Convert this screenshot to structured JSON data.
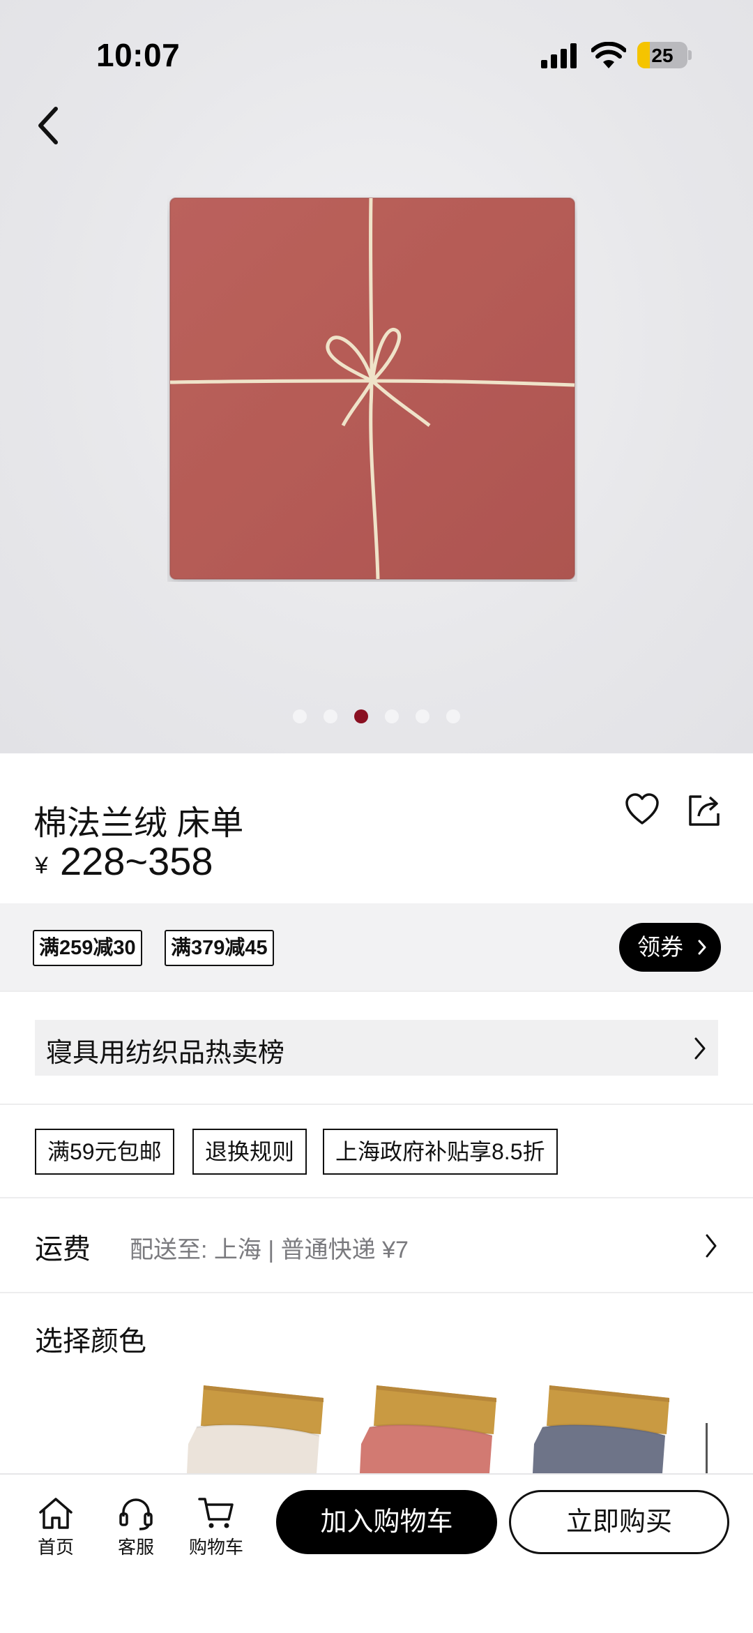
{
  "status_bar": {
    "time": "10:07",
    "battery": "25",
    "battery_level": 0.25
  },
  "carousel": {
    "total": 6,
    "active_index": 2
  },
  "product": {
    "name": "棉法兰绒 床单",
    "currency": "¥",
    "price_range": "228~358"
  },
  "promotions": {
    "tags": [
      "满259减30",
      "满379减45"
    ],
    "coupon_button": "领券"
  },
  "ranking": {
    "label": "寝具用纺织品热卖榜"
  },
  "services": [
    "满59元包邮",
    "退换规则",
    "上海政府补贴享8.5折"
  ],
  "shipping": {
    "label": "运费",
    "detail": "配送至:  上海 | 普通快递 ¥7"
  },
  "color_select": {
    "title": "选择颜色",
    "swatches": [
      {
        "name": "ivory",
        "color": "#ebe3da"
      },
      {
        "name": "terracotta",
        "color": "#d27a72"
      },
      {
        "name": "slate-blue",
        "color": "#6e7488"
      }
    ]
  },
  "bottom_nav": {
    "home": "首页",
    "service": "客服",
    "cart": "购物车",
    "add_to_cart": "加入购物车",
    "buy_now": "立即购买"
  },
  "colors": {
    "product_fabric": "#b75d58",
    "string": "#efe3c9",
    "carousel_active": "#8a1022",
    "battery": "#f5c400"
  }
}
